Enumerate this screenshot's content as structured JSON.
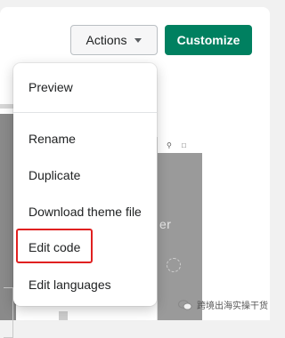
{
  "header": {
    "actions_label": "Actions",
    "customize_label": "Customize"
  },
  "menu": {
    "items": [
      {
        "label": "Preview"
      },
      {
        "label": "Rename"
      },
      {
        "label": "Duplicate"
      },
      {
        "label": "Download theme file"
      },
      {
        "label": "Edit code",
        "highlighted": true
      },
      {
        "label": "Edit languages"
      }
    ]
  },
  "preview": {
    "hero_text": "er"
  },
  "watermark": {
    "text": "跨境出海实操干货",
    "icon": "wechat-icon"
  },
  "colors": {
    "accent": "#008060",
    "highlight": "#e02020"
  }
}
